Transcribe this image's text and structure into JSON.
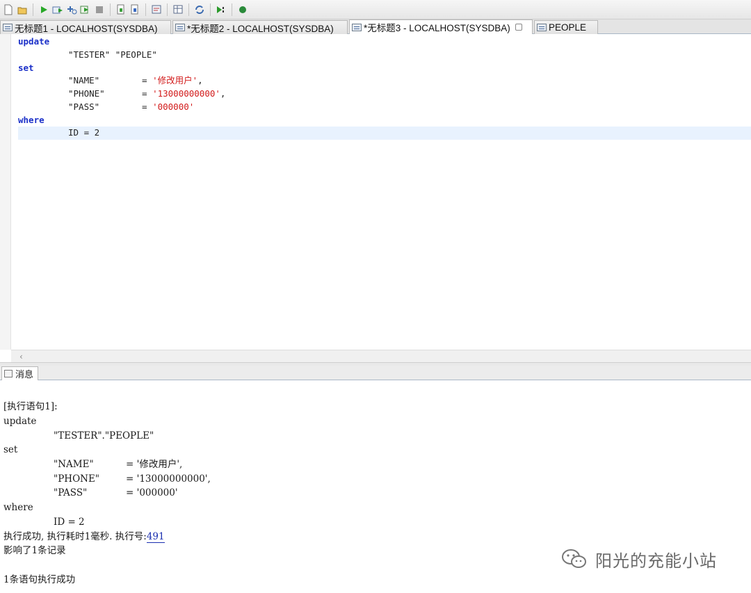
{
  "toolbar": {
    "icons": [
      "new-file-icon",
      "open-file-icon",
      "run-icon",
      "run-script-icon",
      "explain-icon",
      "step-icon",
      "stop-icon",
      "import-icon",
      "export-icon",
      "query-icon",
      "table-icon",
      "refresh-icon",
      "debug-icon",
      "record-icon"
    ]
  },
  "tabs": [
    {
      "label": "无标题1 - LOCALHOST(SYSDBA)",
      "active": false
    },
    {
      "label": "*无标题2 - LOCALHOST(SYSDBA)",
      "active": false
    },
    {
      "label": "*无标题3 - LOCALHOST(SYSDBA)",
      "active": true
    },
    {
      "label": "PEOPLE",
      "active": false
    }
  ],
  "editor": {
    "kw_update": "update",
    "table": "\"TESTER\" \"PEOPLE\"",
    "kw_set": "set",
    "set_rows": [
      {
        "col": "\"NAME\"",
        "eq": "=",
        "val": "'修改用户'",
        "tail": ","
      },
      {
        "col": "\"PHONE\"",
        "eq": "=",
        "val": "'13000000000'",
        "tail": ","
      },
      {
        "col": "\"PASS\"",
        "eq": "=",
        "val": "'000000'",
        "tail": ""
      }
    ],
    "kw_where": "where",
    "condition": "ID = 2"
  },
  "messages": {
    "tab_label": "消息",
    "stmt_header": "[执行语句1]:",
    "update": "update",
    "table": "\"TESTER\".\"PEOPLE\"",
    "set": "set",
    "set_rows": [
      {
        "col": "\"NAME\"",
        "rest": "= '修改用户',"
      },
      {
        "col": "\"PHONE\"",
        "rest": "= '13000000000',"
      },
      {
        "col": "\"PASS\"",
        "rest": "= '000000'"
      }
    ],
    "where": "where",
    "condition": "ID = 2",
    "result_prefix": "执行成功, 执行耗时1毫秒. 执行号:",
    "exec_no": "491",
    "affected": "影响了1条记录",
    "summary": "1条语句执行成功"
  },
  "watermark": {
    "text": "阳光的充能小站"
  },
  "colors": {
    "keyword": "#1a2fc8",
    "string": "#d21a1a",
    "current_line": "#e8f2fe",
    "link": "#1a2fb0"
  }
}
